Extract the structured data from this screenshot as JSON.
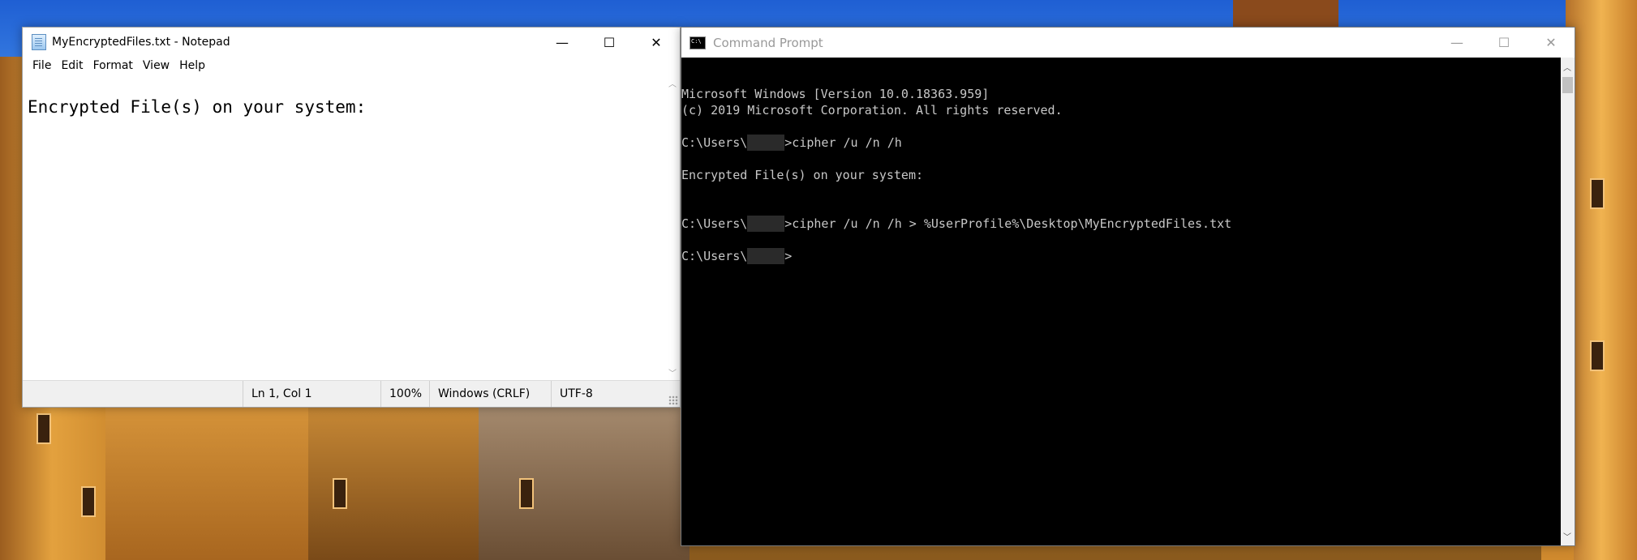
{
  "notepad": {
    "title": "MyEncryptedFiles.txt - Notepad",
    "menu": [
      "File",
      "Edit",
      "Format",
      "View",
      "Help"
    ],
    "content": "Encrypted File(s) on your system:",
    "status": {
      "position": "Ln 1, Col 1",
      "zoom": "100%",
      "line_endings": "Windows (CRLF)",
      "encoding": "UTF-8"
    }
  },
  "cmd": {
    "title": "Command Prompt",
    "lines": {
      "l1": "Microsoft Windows [Version 10.0.18363.959]",
      "l2": "(c) 2019 Microsoft Corporation. All rights reserved.",
      "prompt_prefix": "C:\\Users\\",
      "cmd1": ">cipher /u /n /h",
      "l4": "Encrypted File(s) on your system:",
      "cmd2": ">cipher /u /n /h > %UserProfile%\\Desktop\\MyEncryptedFiles.txt",
      "cmd3": ">"
    }
  },
  "caption": {
    "minimize": "—",
    "maximize": "☐",
    "close": "✕"
  }
}
